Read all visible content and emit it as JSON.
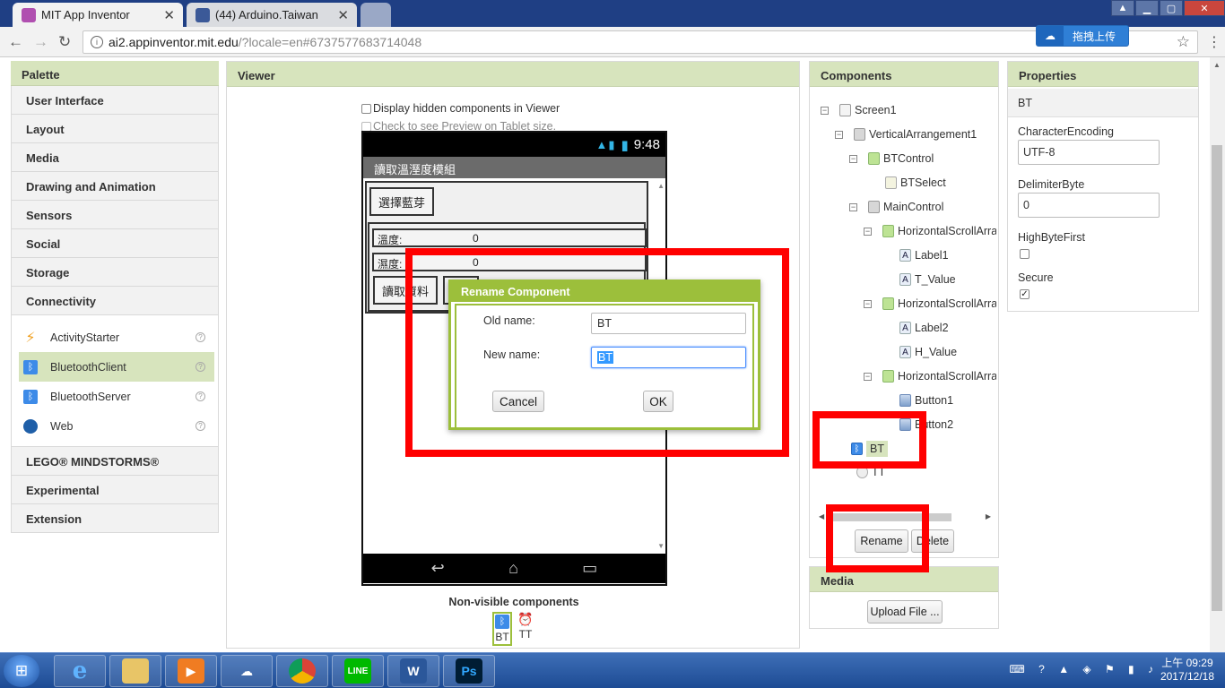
{
  "browser": {
    "tabs": [
      {
        "title": "MIT App Inventor",
        "active": true
      },
      {
        "title": "(44) Arduino.Taiwan",
        "active": false
      }
    ],
    "close_glyph": "✕",
    "url_host": "ai2.appinventor.mit.edu",
    "url_path": "/?locale=en#6737577683714048",
    "extension_label": "拖拽上传",
    "colors": {
      "tabbar": "#1f3f84",
      "accent": "#9cbf3b",
      "highlight": "#ff0000"
    }
  },
  "palette": {
    "title": "Palette",
    "categories_top": [
      "User Interface",
      "Layout",
      "Media",
      "Drawing and Animation",
      "Sensors",
      "Social",
      "Storage",
      "Connectivity"
    ],
    "items": [
      {
        "label": "ActivityStarter",
        "icon": "bolt-icon"
      },
      {
        "label": "BluetoothClient",
        "icon": "bluetooth-icon",
        "selected": true
      },
      {
        "label": "BluetoothServer",
        "icon": "bluetooth-icon"
      },
      {
        "label": "Web",
        "icon": "globe-icon"
      }
    ],
    "help_glyph": "?",
    "categories_bottom": [
      "LEGO® MINDSTORMS®",
      "Experimental",
      "Extension"
    ]
  },
  "viewer": {
    "title": "Viewer",
    "display_hidden": "Display hidden components in Viewer",
    "tablet_preview": "Check to see Preview on Tablet size.",
    "phone": {
      "time": "9:48",
      "app_title": "讀取溫溼度模組",
      "select_button": "選擇藍芽",
      "temp_label": "溫度:",
      "temp_value": "0",
      "hum_label": "濕度:",
      "hum_value": "0",
      "read_button": "讀取資料",
      "read_button2": "讀"
    },
    "nonvisible_title": "Non-visible components",
    "nonvisible": [
      {
        "label": "BT",
        "icon": "bluetooth-icon"
      },
      {
        "label": "TT",
        "icon": "clock-icon"
      }
    ]
  },
  "dialog": {
    "title": "Rename Component",
    "old_label": "Old name:",
    "old_value": "BT",
    "new_label": "New name:",
    "new_value": "BT",
    "cancel": "Cancel",
    "ok": "OK"
  },
  "components": {
    "title": "Components",
    "tree": [
      {
        "label": "Screen1"
      },
      {
        "label": "VerticalArrangement1"
      },
      {
        "label": "BTControl"
      },
      {
        "label": "BTSelect"
      },
      {
        "label": "MainControl"
      },
      {
        "label": "HorizontalScrollArra"
      },
      {
        "label": "Label1"
      },
      {
        "label": "T_Value"
      },
      {
        "label": "HorizontalScrollArra"
      },
      {
        "label": "Label2"
      },
      {
        "label": "H_Value"
      },
      {
        "label": "HorizontalScrollArra"
      },
      {
        "label": "Button1"
      },
      {
        "label": "Button2"
      },
      {
        "label": "BT"
      },
      {
        "label": "TT"
      }
    ],
    "rename_button": "Rename",
    "delete_button": "Delete"
  },
  "media": {
    "title": "Media",
    "upload_button": "Upload File ..."
  },
  "properties": {
    "title": "Properties",
    "component": "BT",
    "character_encoding_label": "CharacterEncoding",
    "character_encoding_value": "UTF-8",
    "delimiter_label": "DelimiterByte",
    "delimiter_value": "0",
    "highbyte_label": "HighByteFirst",
    "secure_label": "Secure",
    "check_glyph": "✓"
  },
  "taskbar": {
    "apps": [
      "e",
      "LINE",
      "W",
      "Ps"
    ],
    "clock_time": "上午 09:29",
    "clock_date": "2017/12/18"
  }
}
